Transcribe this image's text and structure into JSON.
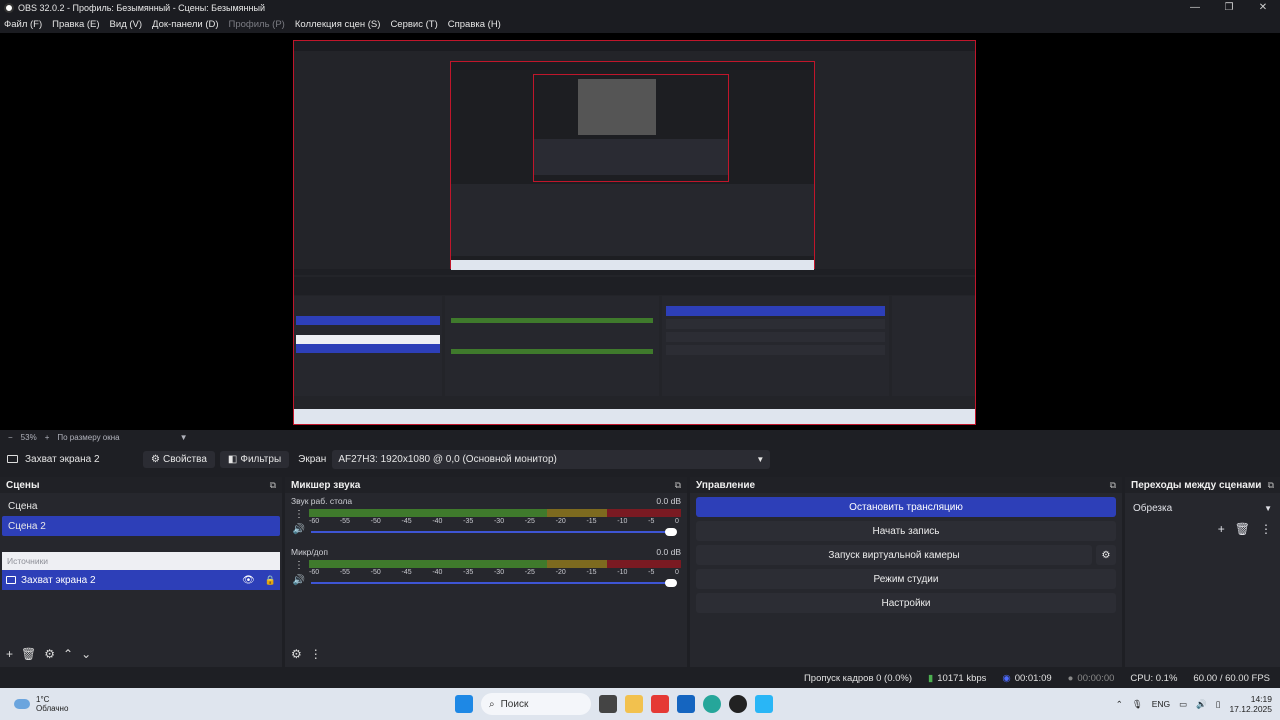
{
  "window": {
    "title": "OBS 32.0.2 - Профиль: Безымянный - Сцены: Безымянный"
  },
  "menu": [
    {
      "label": "Файл (F)",
      "disabled": false
    },
    {
      "label": "Правка (E)",
      "disabled": false
    },
    {
      "label": "Вид (V)",
      "disabled": false
    },
    {
      "label": "Док-панели (D)",
      "disabled": false
    },
    {
      "label": "Профиль (P)",
      "disabled": true
    },
    {
      "label": "Коллекция сцен (S)",
      "disabled": false
    },
    {
      "label": "Сервис (T)",
      "disabled": false
    },
    {
      "label": "Справка (H)",
      "disabled": false
    }
  ],
  "zoom": {
    "value": "53%",
    "minus": "−",
    "plus": "+",
    "fit": "По размеру окна"
  },
  "source_bar": {
    "name": "Захват экрана 2",
    "properties": "Свойства",
    "filters": "Фильтры",
    "screen_label": "Экран",
    "screen_value": "AF27H3: 1920x1080 @ 0,0 (Основной монитор)"
  },
  "scenes": {
    "title": "Сцены",
    "items": [
      {
        "label": "Сцена",
        "active": false
      },
      {
        "label": "Сцена 2",
        "active": true
      }
    ]
  },
  "sources": {
    "title": "Источники",
    "items": [
      {
        "label": "Захват экрана 2"
      }
    ]
  },
  "mixer": {
    "title": "Микшер звука",
    "scale": [
      "-60",
      "-55",
      "-50",
      "-45",
      "-40",
      "-35",
      "-30",
      "-25",
      "-20",
      "-15",
      "-10",
      "-5",
      "0"
    ],
    "tracks": [
      {
        "name": "Звук раб. стола",
        "db": "0.0 dB",
        "volume": 1.0
      },
      {
        "name": "Микр/доп",
        "db": "0.0 dB",
        "volume": 1.0
      }
    ]
  },
  "controls": {
    "title": "Управление",
    "stop_stream": "Остановить трансляцию",
    "start_record": "Начать запись",
    "virtual_cam": "Запуск виртуальной камеры",
    "studio_mode": "Режим студии",
    "settings": "Настройки"
  },
  "transitions": {
    "title": "Переходы между сценами",
    "selected": "Обрезка"
  },
  "status": {
    "dropped": "Пропуск кадров 0 (0.0%)",
    "bitrate": "10171 kbps",
    "stream_time": "00:01:09",
    "record_time": "00:00:00",
    "cpu": "CPU: 0.1%",
    "fps": "60.00 / 60.00 FPS"
  },
  "taskbar": {
    "weather_temp": "1°C",
    "weather_desc": "Облачно",
    "search": "Поиск",
    "lang": "ENG",
    "time": "14:19",
    "date": "17.12.2025"
  },
  "colors": {
    "accent": "#2d3fb8",
    "canvas_border": "#c0162b"
  }
}
